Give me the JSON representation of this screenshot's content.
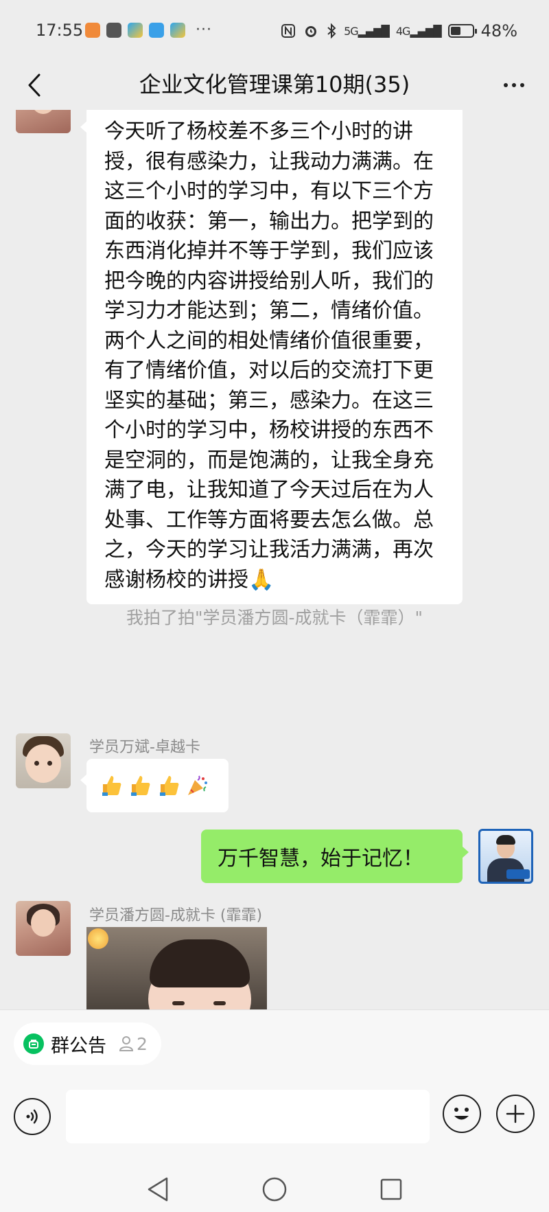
{
  "status_bar": {
    "time": "17:55",
    "network_5g": "5G",
    "network_4g": "4G",
    "battery_percent": "48%",
    "battery_level": 0.48
  },
  "header": {
    "back_icon": "chevron-left-icon",
    "title": "企业文化管理课第10期(35)",
    "more_icon": "more-horizontal-icon"
  },
  "messages": {
    "long_message": {
      "text": "今天听了杨校差不多三个小时的讲授，很有感染力，让我动力满满。在这三个小时的学习中，有以下三个方面的收获：第一，输出力。把学到的东西消化掉并不等于学到，我们应该把今晚的内容讲授给别人听，我们的学习力才能达到；第二，情绪价值。两个人之间的相处情绪价值很重要，有了情绪价值，对以后的交流打下更坚实的基础；第三，感染力。在这三个小时的学习中，杨校讲授的东西不是空洞的，而是饱满的，让我全身充满了电，让我知道了今天过后在为人处事、工作等方面将要去怎么做。总之，今天的学习让我活力满满，再次感谢杨校的讲授🙏"
    },
    "pat_notice": "我拍了拍\"学员潘方圆-成就卡（霏霏）\"",
    "wanbin": {
      "sender": "学员万斌-卓越卡",
      "content_icons": [
        "thumbs-up-icon",
        "thumbs-up-icon",
        "thumbs-up-icon",
        "party-popper-icon"
      ]
    },
    "mine": {
      "text": "万千智慧，始于记忆！"
    },
    "panfangyuan": {
      "sender": "学员潘方圆-成就卡 (霏霏)",
      "sticker": "baby-sticker-image"
    }
  },
  "bottom": {
    "notice_label": "群公告",
    "notice_count": "2",
    "input_placeholder": ""
  },
  "colors": {
    "background": "#ededed",
    "my_bubble": "#95ec69",
    "accent_green": "#07c160"
  }
}
